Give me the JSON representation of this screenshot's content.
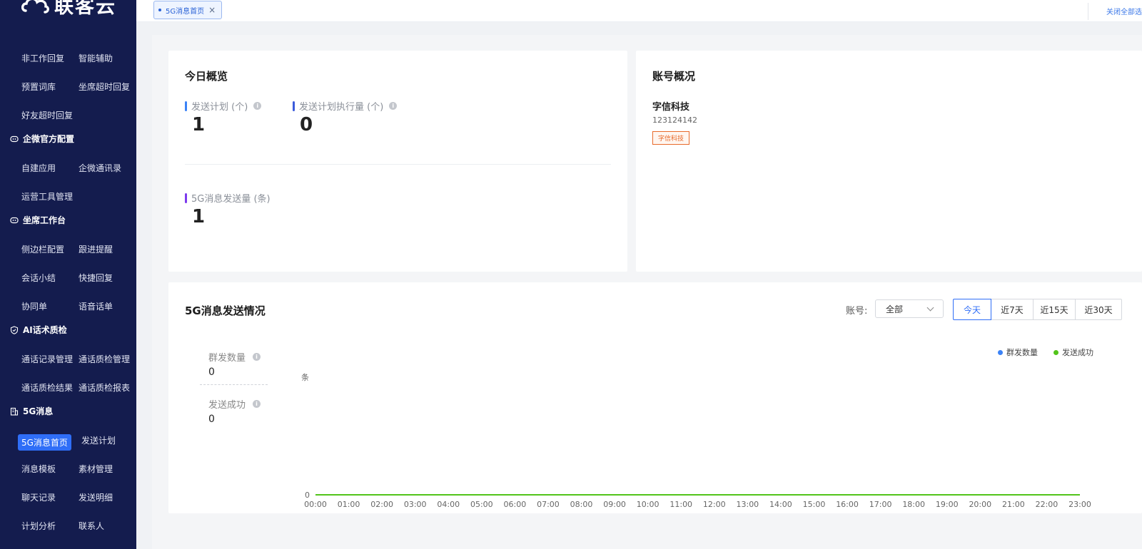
{
  "brand": {
    "logo_text": "联客云"
  },
  "sidebar": {
    "rows": [
      [
        "非工作回复",
        "智能辅助"
      ],
      [
        "预置词库",
        "坐席超时回复"
      ],
      [
        "好友超时回复"
      ]
    ],
    "groups": [
      {
        "label": "企微官方配置",
        "icon": "robot-icon",
        "rows": [
          [
            "自建应用",
            "企微通讯录"
          ],
          [
            "运营工具管理"
          ]
        ]
      },
      {
        "label": "坐席工作台",
        "icon": "robot-icon",
        "rows": [
          [
            "侧边栏配置",
            "跟进提醒"
          ],
          [
            "会话小结",
            "快捷回复"
          ],
          [
            "协同单",
            "语音话单"
          ]
        ]
      },
      {
        "label": "AI话术质检",
        "icon": "shield-icon",
        "rows": [
          [
            "通话记录管理",
            "通话质检管理"
          ],
          [
            "通话质检结果",
            "通话质检报表"
          ]
        ]
      },
      {
        "label": "5G消息",
        "icon": "building-icon",
        "rows": [
          [
            "5G消息首页",
            "发送计划"
          ],
          [
            "消息模板",
            "素材管理"
          ],
          [
            "聊天记录",
            "发送明细"
          ],
          [
            "计划分析",
            "联系人"
          ]
        ]
      }
    ],
    "active_item": "5G消息首页"
  },
  "topbar": {
    "tab_label": "5G消息首页",
    "close_all": "关闭全部选"
  },
  "overview": {
    "title": "今日概览",
    "metrics": [
      {
        "label": "发送计划 (个)",
        "value": "1",
        "color": "#3b82f6"
      },
      {
        "label": "发送计划执行量 (个)",
        "value": "0",
        "color": "#3b5bdb"
      },
      {
        "label": "5G消息发送量 (条)",
        "value": "1",
        "color": "#7c3aed"
      }
    ]
  },
  "account": {
    "title": "账号概况",
    "name": "字信科技",
    "id": "123124142",
    "tag": "字信科技"
  },
  "send_status": {
    "title": "5G消息发送情况",
    "account_label": "账号:",
    "account_value": "全部",
    "ranges": [
      "今天",
      "近7天",
      "近15天",
      "近30天"
    ],
    "active_range": "今天",
    "stats": [
      {
        "label": "群发数量",
        "value": "0"
      },
      {
        "label": "发送成功",
        "value": "0"
      }
    ]
  },
  "chart_data": {
    "type": "line",
    "ylabel": "条",
    "x": [
      "00:00",
      "01:00",
      "02:00",
      "03:00",
      "04:00",
      "05:00",
      "06:00",
      "07:00",
      "08:00",
      "09:00",
      "10:00",
      "11:00",
      "12:00",
      "13:00",
      "14:00",
      "15:00",
      "16:00",
      "17:00",
      "18:00",
      "19:00",
      "20:00",
      "21:00",
      "22:00",
      "23:00"
    ],
    "series": [
      {
        "name": "群发数量",
        "color": "#3b82f6",
        "values": [
          0,
          0,
          0,
          0,
          0,
          0,
          0,
          0,
          0,
          0,
          0,
          0,
          0,
          0,
          0,
          0,
          0,
          0,
          0,
          0,
          0,
          0,
          0,
          0
        ]
      },
      {
        "name": "发送成功",
        "color": "#52c41a",
        "values": [
          0,
          0,
          0,
          0,
          0,
          0,
          0,
          0,
          0,
          0,
          0,
          0,
          0,
          0,
          0,
          0,
          0,
          0,
          0,
          0,
          0,
          0,
          0,
          0
        ]
      }
    ],
    "y_ticks": [
      "0"
    ],
    "legend_position": "top-right"
  }
}
